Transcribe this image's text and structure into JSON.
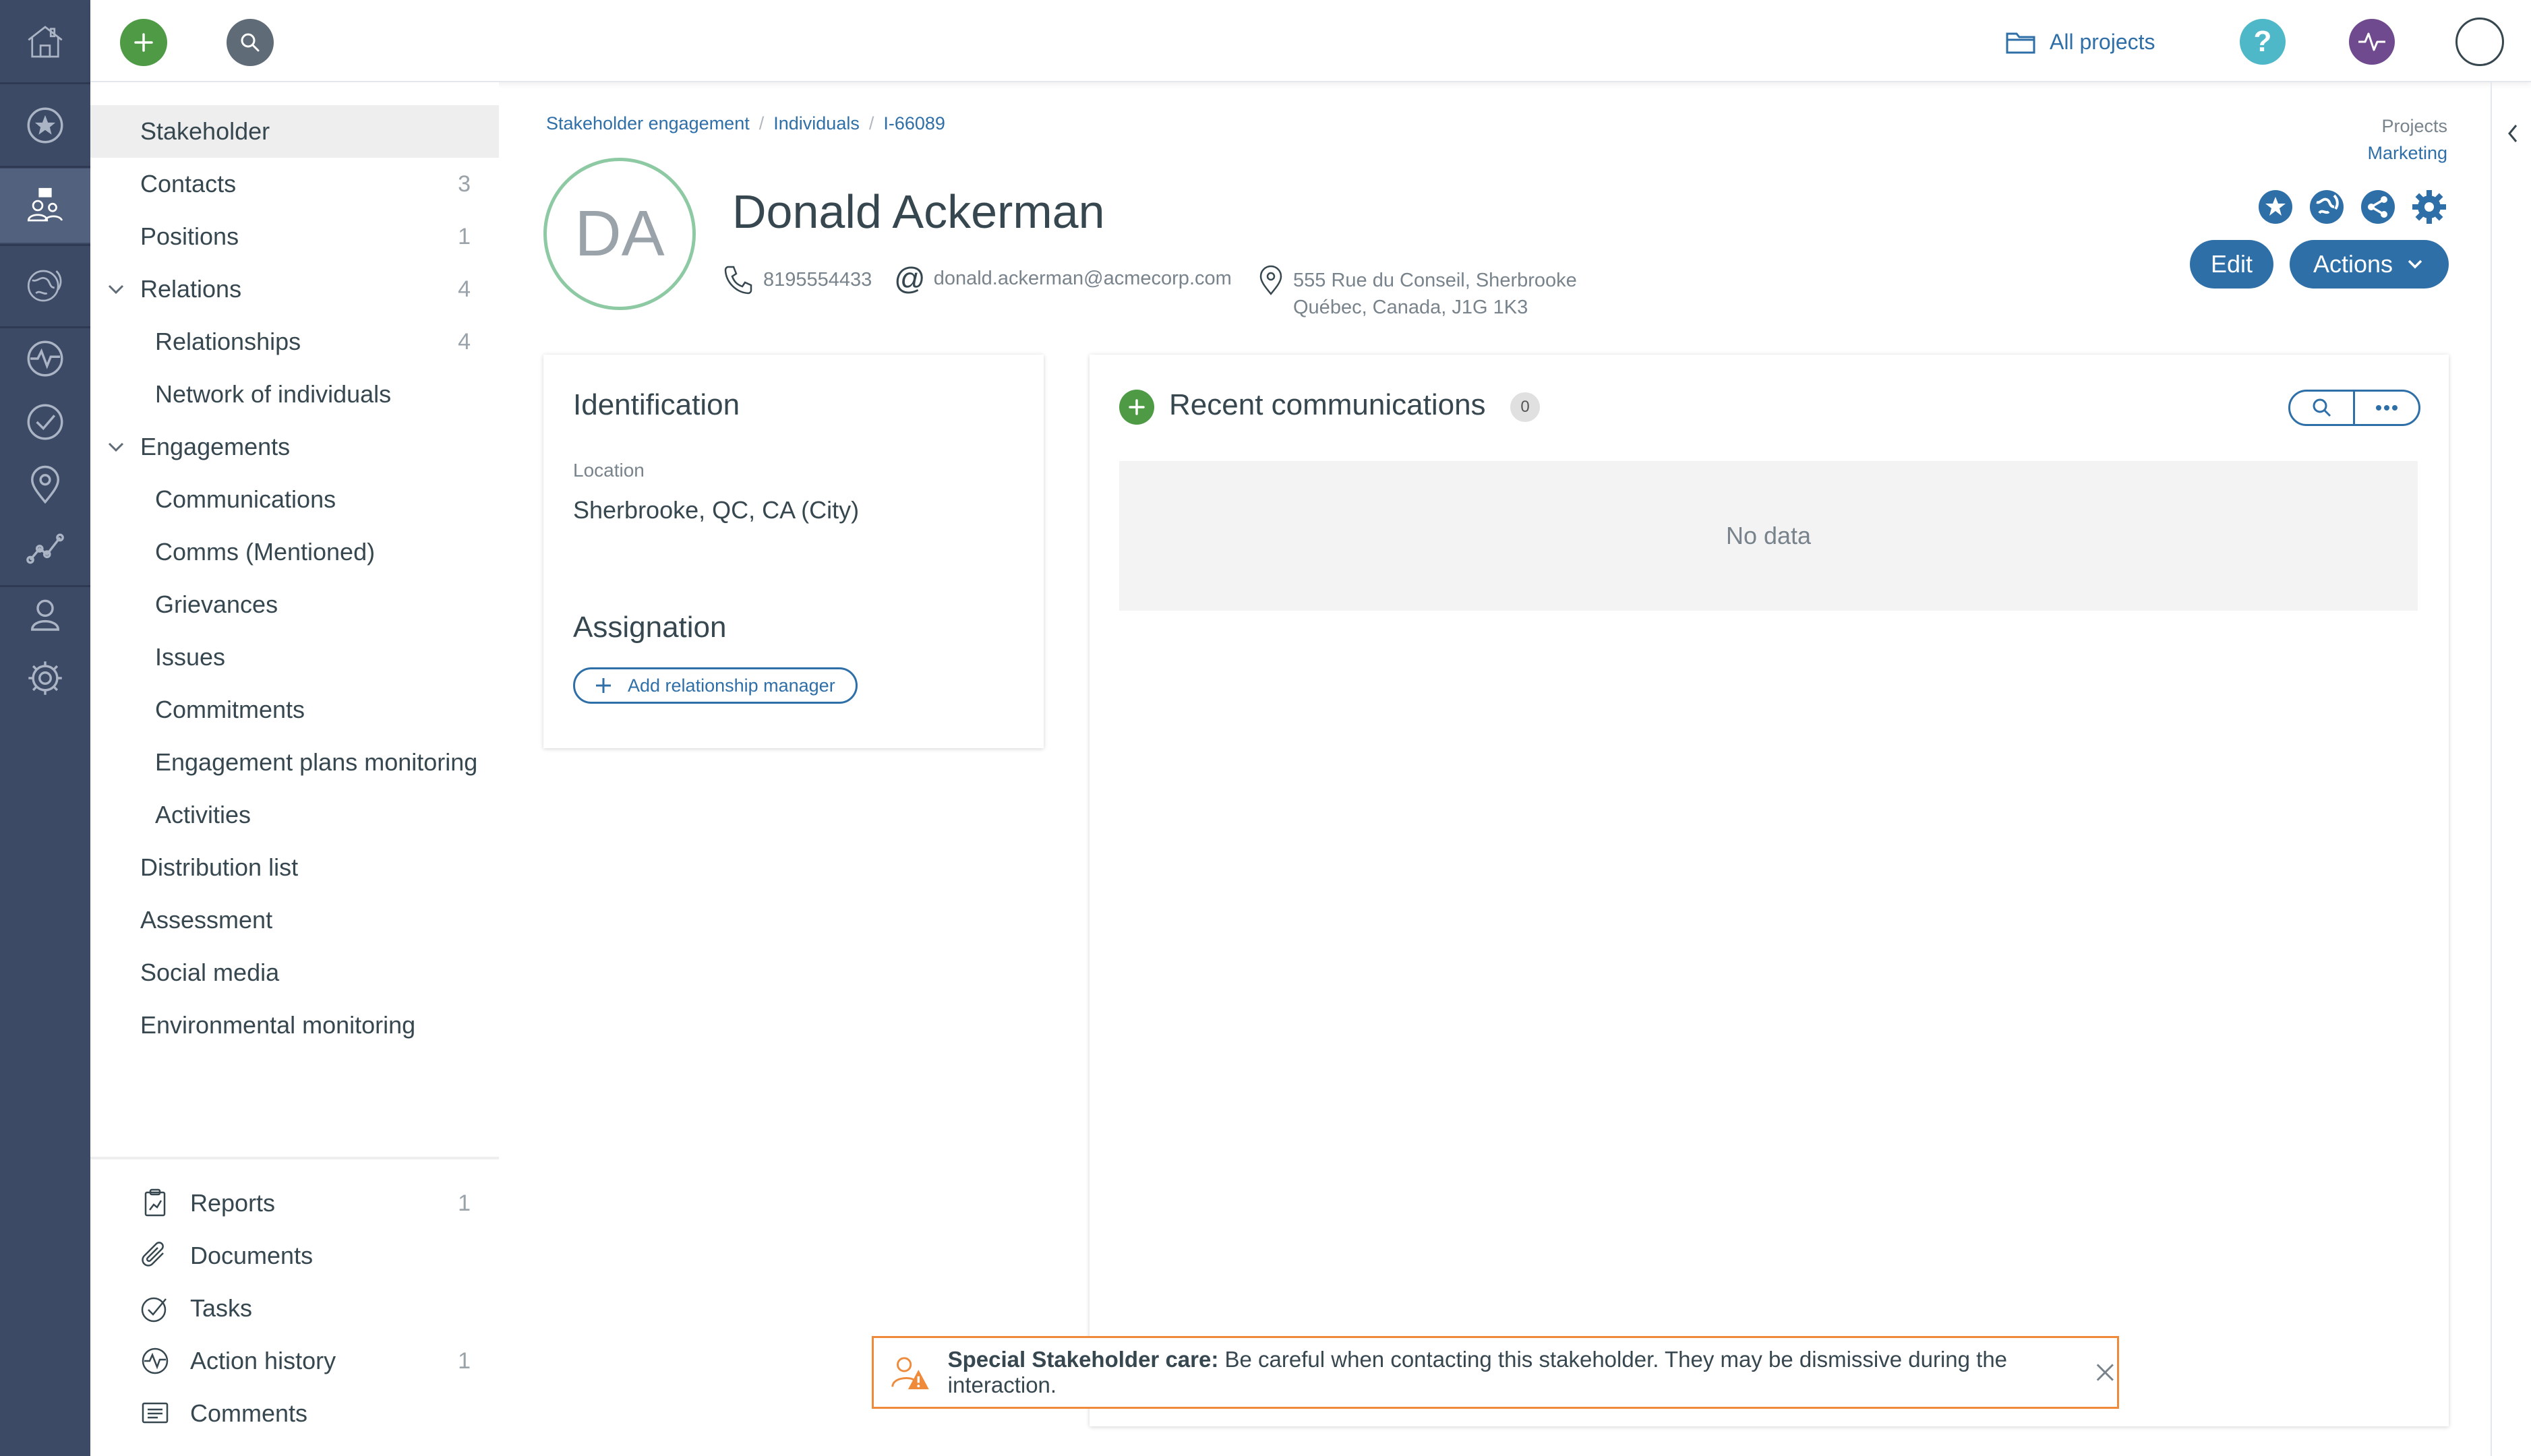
{
  "topbar": {
    "all_projects_label": "All projects",
    "help_glyph": "?"
  },
  "sidenav": {
    "items": [
      {
        "label": "Stakeholder",
        "count": ""
      },
      {
        "label": "Contacts",
        "count": "3"
      },
      {
        "label": "Positions",
        "count": "1"
      },
      {
        "label": "Relations",
        "count": "4"
      },
      {
        "label": "Relationships",
        "count": "4"
      },
      {
        "label": "Network of individuals",
        "count": ""
      },
      {
        "label": "Engagements",
        "count": ""
      },
      {
        "label": "Communications",
        "count": ""
      },
      {
        "label": "Comms (Mentioned)",
        "count": ""
      },
      {
        "label": "Grievances",
        "count": ""
      },
      {
        "label": "Issues",
        "count": ""
      },
      {
        "label": "Commitments",
        "count": ""
      },
      {
        "label": "Engagement plans monitoring",
        "count": ""
      },
      {
        "label": "Activities",
        "count": ""
      },
      {
        "label": "Distribution list",
        "count": ""
      },
      {
        "label": "Assessment",
        "count": ""
      },
      {
        "label": "Social media",
        "count": ""
      },
      {
        "label": "Environmental monitoring",
        "count": ""
      }
    ],
    "bottom_items": [
      {
        "label": "Reports",
        "count": "1",
        "icon": "report-icon"
      },
      {
        "label": "Documents",
        "count": "",
        "icon": "paperclip-icon"
      },
      {
        "label": "Tasks",
        "count": "",
        "icon": "check-circle-icon"
      },
      {
        "label": "Action history",
        "count": "1",
        "icon": "pulse-icon"
      },
      {
        "label": "Comments",
        "count": "",
        "icon": "comment-icon"
      }
    ]
  },
  "breadcrumb": {
    "items": [
      "Stakeholder engagement",
      "Individuals",
      "I-66089"
    ],
    "separator": "/"
  },
  "project": {
    "label": "Projects",
    "value": "Marketing"
  },
  "person": {
    "initials": "DA",
    "name": "Donald Ackerman",
    "phone": "8195554433",
    "email": "donald.ackerman@acmecorp.com",
    "address_line1": "555 Rue du Conseil, Sherbrooke",
    "address_line2": "Québec, Canada, J1G 1K3"
  },
  "header_buttons": {
    "edit": "Edit",
    "actions": "Actions"
  },
  "identification": {
    "title": "Identification",
    "location_label": "Location",
    "location_value": "Sherbrooke, QC, CA (City)"
  },
  "assignation": {
    "title": "Assignation",
    "add_manager": "Add relationship manager"
  },
  "communications": {
    "title": "Recent communications",
    "count": "0",
    "empty_text": "No data"
  },
  "warning": {
    "title": "Special Stakeholder care:",
    "message": "Be careful when contacting this stakeholder. They may be dismissive during the interaction."
  },
  "colors": {
    "rail": "#3c4a66",
    "accent_blue": "#2f6fa8",
    "green": "#4e9a45",
    "warning_orange": "#ef8a3a"
  }
}
